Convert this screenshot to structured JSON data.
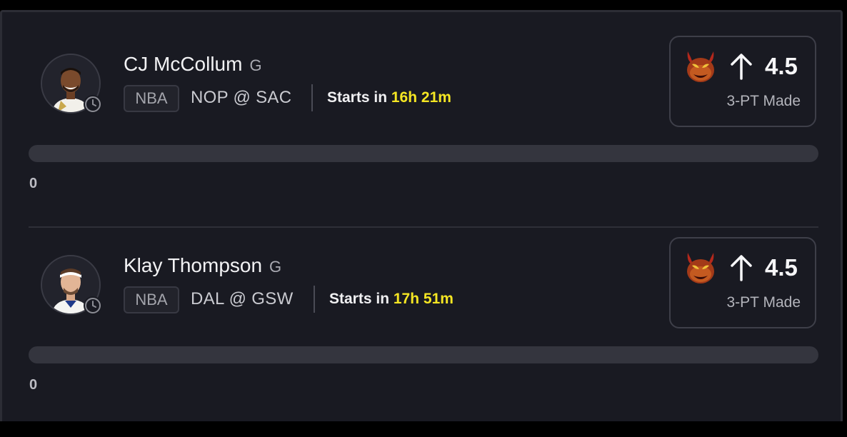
{
  "picks": [
    {
      "player_name": "CJ McCollum",
      "position": "G",
      "league": "NBA",
      "matchup": "NOP @ SAC",
      "starts_prefix": "Starts in",
      "starts_time": "16h 21m",
      "direction_icon": "arrow-up-icon",
      "line": "4.5",
      "stat": "3-PT Made",
      "progress_value": "0",
      "progress_fraction": 0
    },
    {
      "player_name": "Klay Thompson",
      "position": "G",
      "league": "NBA",
      "matchup": "DAL @ GSW",
      "starts_prefix": "Starts in",
      "starts_time": "17h 51m",
      "direction_icon": "arrow-up-icon",
      "line": "4.5",
      "stat": "3-PT Made",
      "progress_value": "0",
      "progress_fraction": 0
    }
  ],
  "colors": {
    "background": "#191a22",
    "accent_time": "#f5e623",
    "progress_track": "#34353e"
  }
}
